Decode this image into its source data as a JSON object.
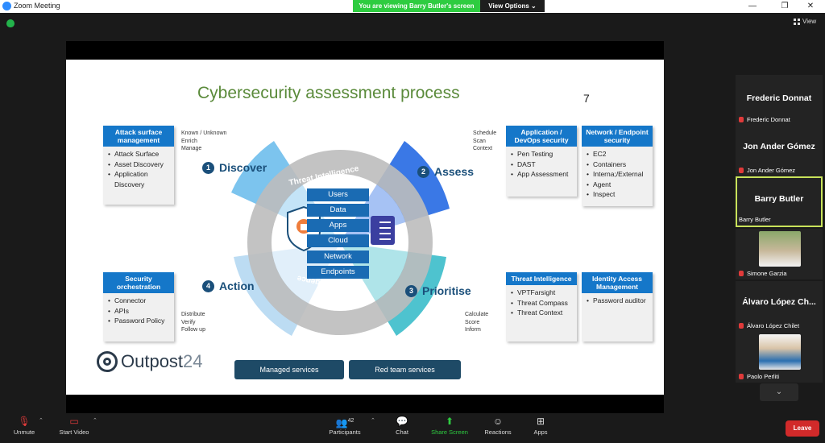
{
  "window": {
    "title": "Zoom Meeting",
    "minimize": "—",
    "maximize": "❐",
    "close": "✕"
  },
  "banner": {
    "viewing": "You are viewing Barry Butler's screen",
    "view_options": "View Options ⌄"
  },
  "top": {
    "view_label": "View"
  },
  "slide": {
    "title": "Cybersecurity assessment process",
    "page_number": "7",
    "ring_top": "Threat Intelligence",
    "ring_bottom": "Threat Intelligence",
    "stack": [
      "Users",
      "Data",
      "Apps",
      "Cloud",
      "Network",
      "Endpoints"
    ],
    "phases": {
      "discover": {
        "num": "1",
        "label": "Discover"
      },
      "assess": {
        "num": "2",
        "label": "Assess"
      },
      "prioritise": {
        "num": "3",
        "label": "Prioritise"
      },
      "action": {
        "num": "4",
        "label": "Action"
      }
    },
    "notes": {
      "discover": [
        "Known / Unknown",
        "Enrich",
        "Manage"
      ],
      "assess": [
        "Schedule",
        "Scan",
        "Context"
      ],
      "prioritise": [
        "Calculate",
        "Score",
        "Inform"
      ],
      "action": [
        "Distribute",
        "Verify",
        "Follow up"
      ]
    },
    "cards": {
      "attack_surface": {
        "header": "Attack surface management",
        "items": [
          "Attack Surface",
          "Asset Discovery",
          "Application Discovery"
        ]
      },
      "appsec": {
        "header": "Application / DevOps security",
        "items": [
          "Pen Testing",
          "DAST",
          "App Assessment"
        ]
      },
      "network": {
        "header": "Network / Endpoint security",
        "items": [
          "EC2",
          "Containers",
          "Interna;/External",
          "Agent",
          "Inspect"
        ]
      },
      "orchestration": {
        "header": "Security orchestration",
        "items": [
          "Connector",
          "APIs",
          "Password Policy"
        ]
      },
      "threat_intel": {
        "header": "Threat Intelligence",
        "items": [
          "VPTFarsight",
          "Threat Compass",
          "Threat Context"
        ]
      },
      "iam": {
        "header": "Identity Access Management",
        "items": [
          "Password auditor"
        ]
      }
    },
    "logo": {
      "main": "Outpost",
      "suffix": "24"
    },
    "buttons": {
      "managed": "Managed services",
      "redteam": "Red team services"
    }
  },
  "participants": [
    {
      "name": "Frederic Donnat",
      "label": "Frederic Donnat"
    },
    {
      "name": "Jon Ander Gómez",
      "label": "Jon Ander Gómez"
    },
    {
      "name": "Barry Butler",
      "label": "Barry Butler"
    },
    {
      "name": "",
      "label": "Simone Garzia"
    },
    {
      "name": "Álvaro López Ch...",
      "label": "Álvaro López Chilet"
    },
    {
      "name": "",
      "label": "Paolo Perliti"
    }
  ],
  "toolbar": {
    "unmute": "Unmute",
    "start_video": "Start Video",
    "participants": "Participants",
    "participants_count": "42",
    "chat": "Chat",
    "share_screen": "Share Screen",
    "reactions": "Reactions",
    "apps": "Apps",
    "leave": "Leave"
  },
  "colors": {
    "accent": "#1577c9",
    "share_green": "#2ecc40",
    "leave_red": "#d12a2a",
    "active_border": "#c8e25a"
  }
}
